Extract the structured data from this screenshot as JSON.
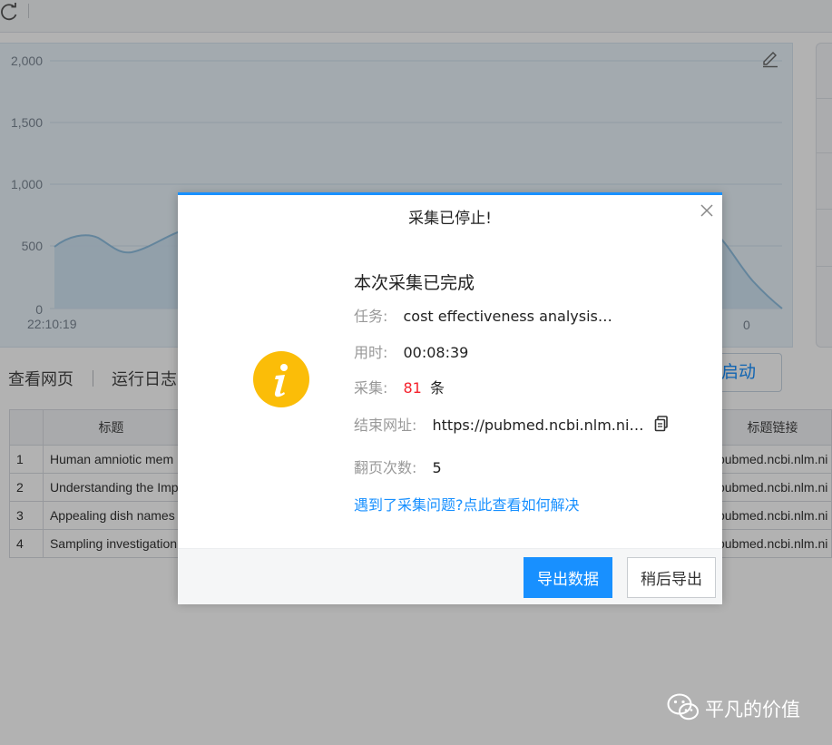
{
  "background": {
    "chart": {
      "y_ticks": [
        "2,000",
        "1,500",
        "1,000",
        "500",
        "0"
      ],
      "x_start_label": "22:10:19",
      "x_end_label": "0"
    },
    "tabs": [
      "查看网页",
      "运行日志"
    ],
    "launch_button_label": "启动",
    "table": {
      "headers": [
        "",
        "标题",
        "",
        "标题链接"
      ],
      "rows": [
        {
          "index": "1",
          "title": "Human amniotic mem",
          "link": "pubmed.ncbi.nlm.ni"
        },
        {
          "index": "2",
          "title": "Understanding the Imp",
          "link": "pubmed.ncbi.nlm.ni"
        },
        {
          "index": "3",
          "title": "Appealing dish names",
          "link": "pubmed.ncbi.nlm.ni"
        },
        {
          "index": "4",
          "title": "Sampling investigation",
          "link": "pubmed.ncbi.nlm.ni"
        }
      ]
    }
  },
  "dialog": {
    "title": "采集已停止!",
    "heading": "本次采集已完成",
    "task_label": "任务:",
    "task_value": "cost effectiveness analysis…",
    "time_label": "用时:",
    "time_value": "00:08:39",
    "count_label": "采集:",
    "count_value": "81",
    "count_unit": "条",
    "end_url_label": "结束网址:",
    "end_url_value": "https://pubmed.ncbi.nlm.ni…",
    "pages_label": "翻页次数:",
    "pages_value": "5",
    "help_link": "遇到了采集问题?点此查看如何解决",
    "export_button": "导出数据",
    "later_button": "稍后导出"
  },
  "watermark": {
    "text": "平凡的价值"
  },
  "colors": {
    "accent": "#1890ff",
    "count_red": "#f5222d",
    "info_yellow": "#fbbd08"
  }
}
